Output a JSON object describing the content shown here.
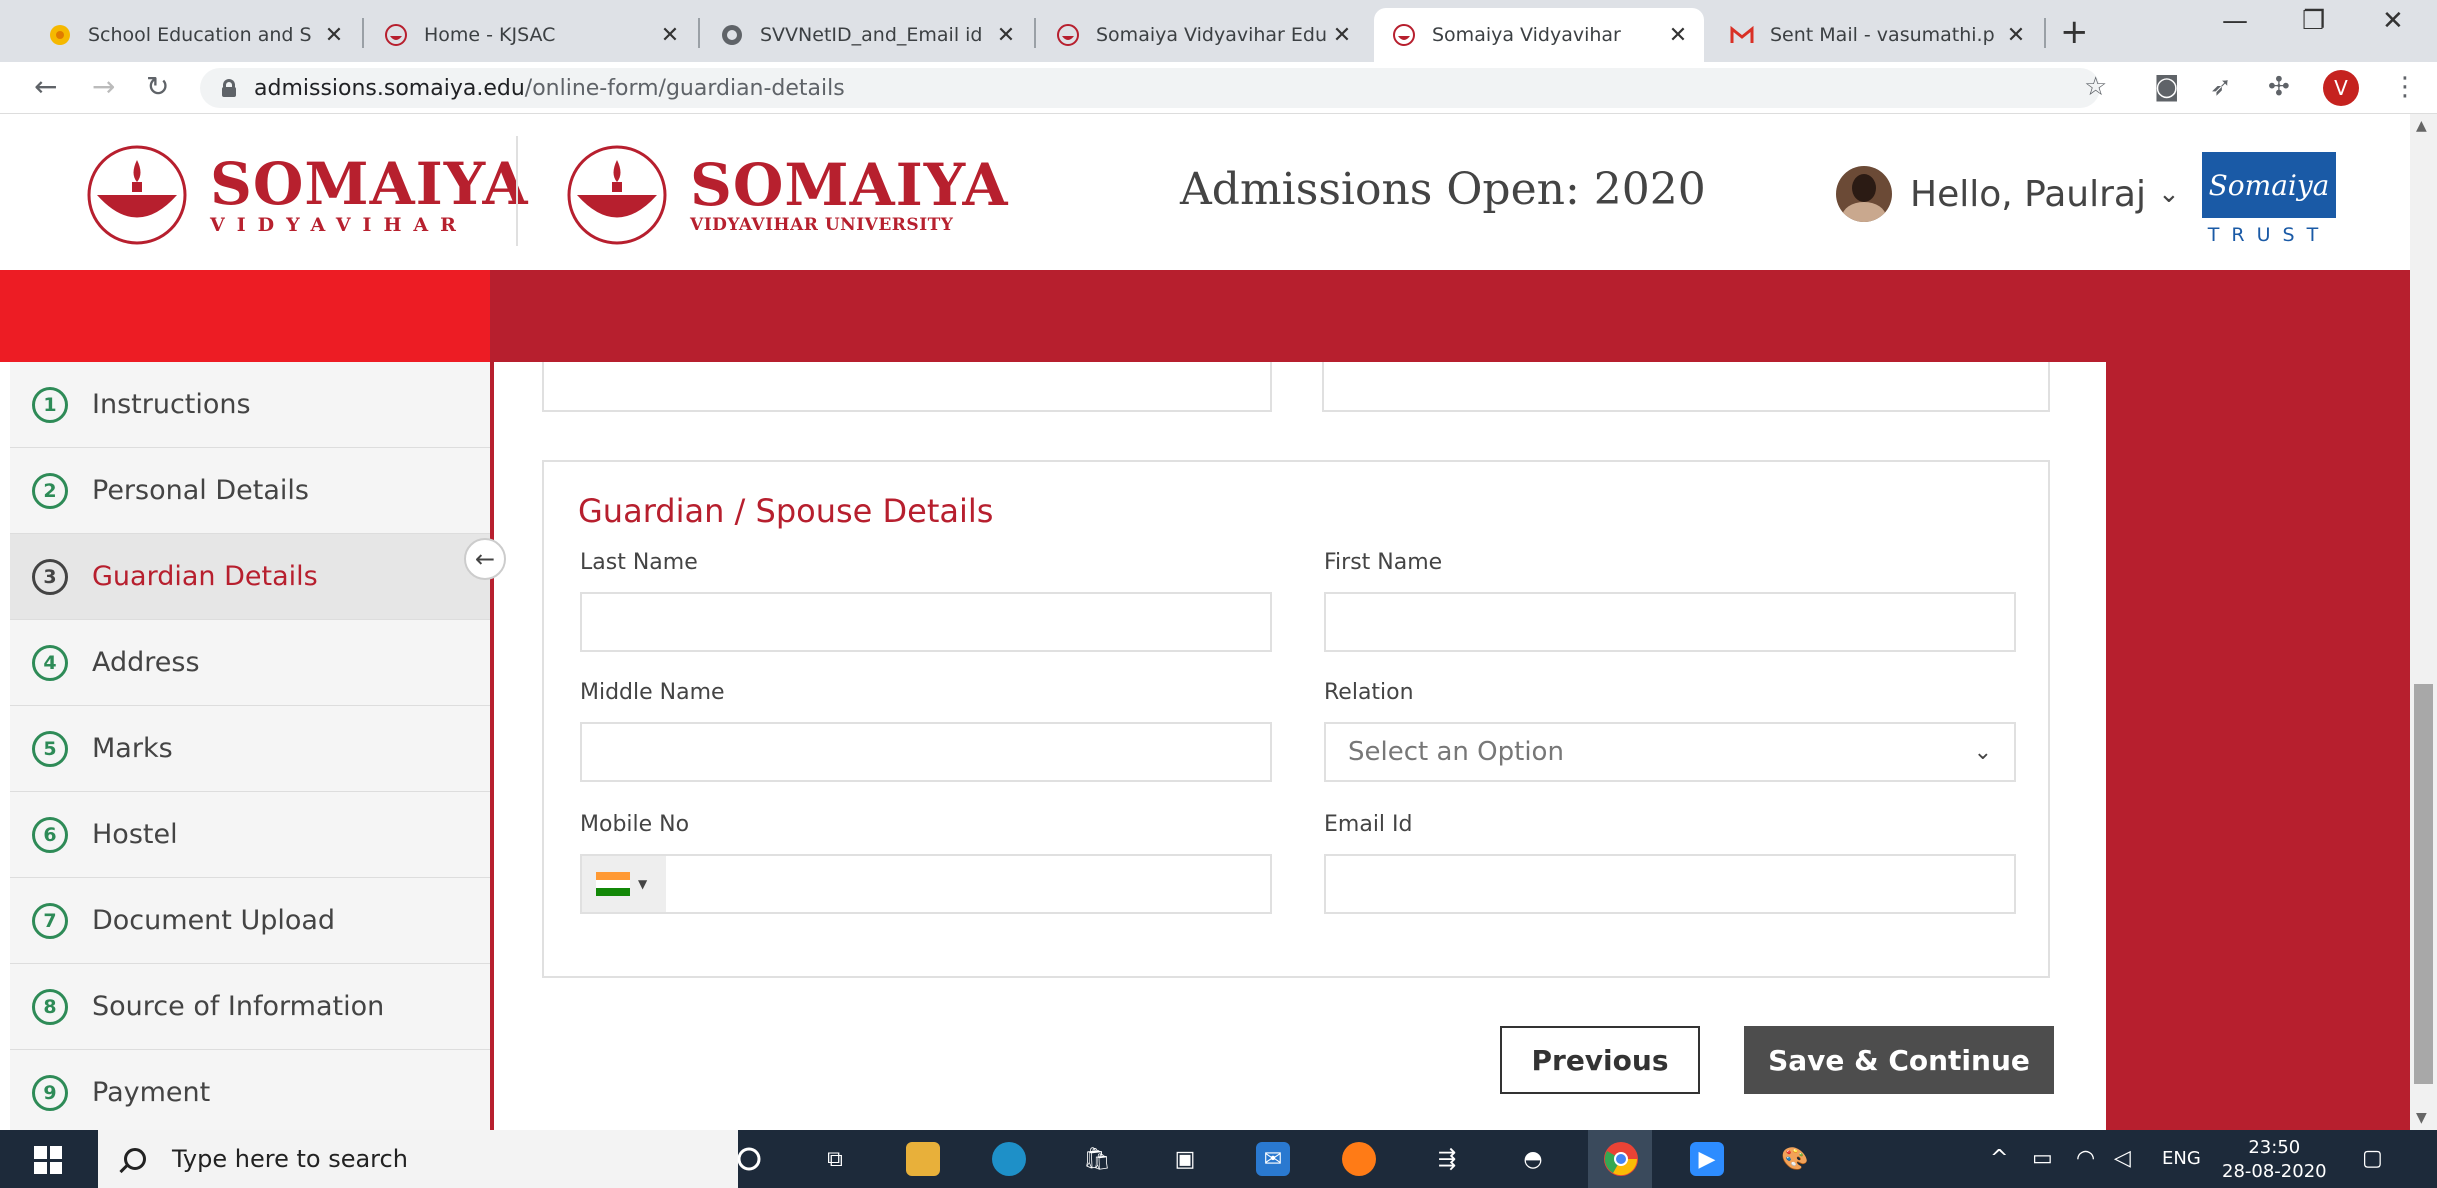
{
  "browser": {
    "tabs": [
      {
        "title": "School Education and S",
        "active": false
      },
      {
        "title": "Home - KJSAC",
        "active": false
      },
      {
        "title": "SVVNetID_and_Email id",
        "active": false
      },
      {
        "title": "Somaiya Vidyavihar Edu",
        "active": false
      },
      {
        "title": "Somaiya Vidyavihar",
        "active": true
      },
      {
        "title": "Sent Mail - vasumathi.p",
        "active": false
      }
    ],
    "url_host": "admissions.somaiya.edu",
    "url_path": "/online-form/guardian-details",
    "profile_initial": "V"
  },
  "header": {
    "logo1": {
      "name": "SOMAIYA",
      "sub": "VIDYAVIHAR"
    },
    "logo2": {
      "name": "SOMAIYA",
      "sub": "VIDYAVIHAR UNIVERSITY"
    },
    "admissions_text": "Admissions Open: 2020",
    "greeting": "Hello, Paulraj",
    "trust_logo_text": "Somaiya",
    "trust_label": "TRUST"
  },
  "sidebar": {
    "steps": [
      {
        "num": "1",
        "label": "Instructions"
      },
      {
        "num": "2",
        "label": "Personal Details"
      },
      {
        "num": "3",
        "label": "Guardian Details",
        "active": true
      },
      {
        "num": "4",
        "label": "Address"
      },
      {
        "num": "5",
        "label": "Marks"
      },
      {
        "num": "6",
        "label": "Hostel"
      },
      {
        "num": "7",
        "label": "Document Upload"
      },
      {
        "num": "8",
        "label": "Source of Information"
      },
      {
        "num": "9",
        "label": "Payment"
      }
    ]
  },
  "form": {
    "section_title": "Guardian / Spouse Details",
    "last_name_label": "Last Name",
    "last_name_value": "",
    "first_name_label": "First Name",
    "first_name_value": "",
    "middle_name_label": "Middle Name",
    "middle_name_value": "",
    "relation_label": "Relation",
    "relation_placeholder": "Select an Option",
    "mobile_label": "Mobile No",
    "mobile_value": "",
    "email_label": "Email Id",
    "email_value": "",
    "previous_button": "Previous",
    "save_button": "Save & Continue"
  },
  "taskbar": {
    "search_placeholder": "Type here to search",
    "language": "ENG",
    "time": "23:50",
    "date": "28-08-2020"
  },
  "colors": {
    "brand_red": "#b71f2e",
    "banner_red": "#ed1c24",
    "step_green": "#2e8b57"
  }
}
